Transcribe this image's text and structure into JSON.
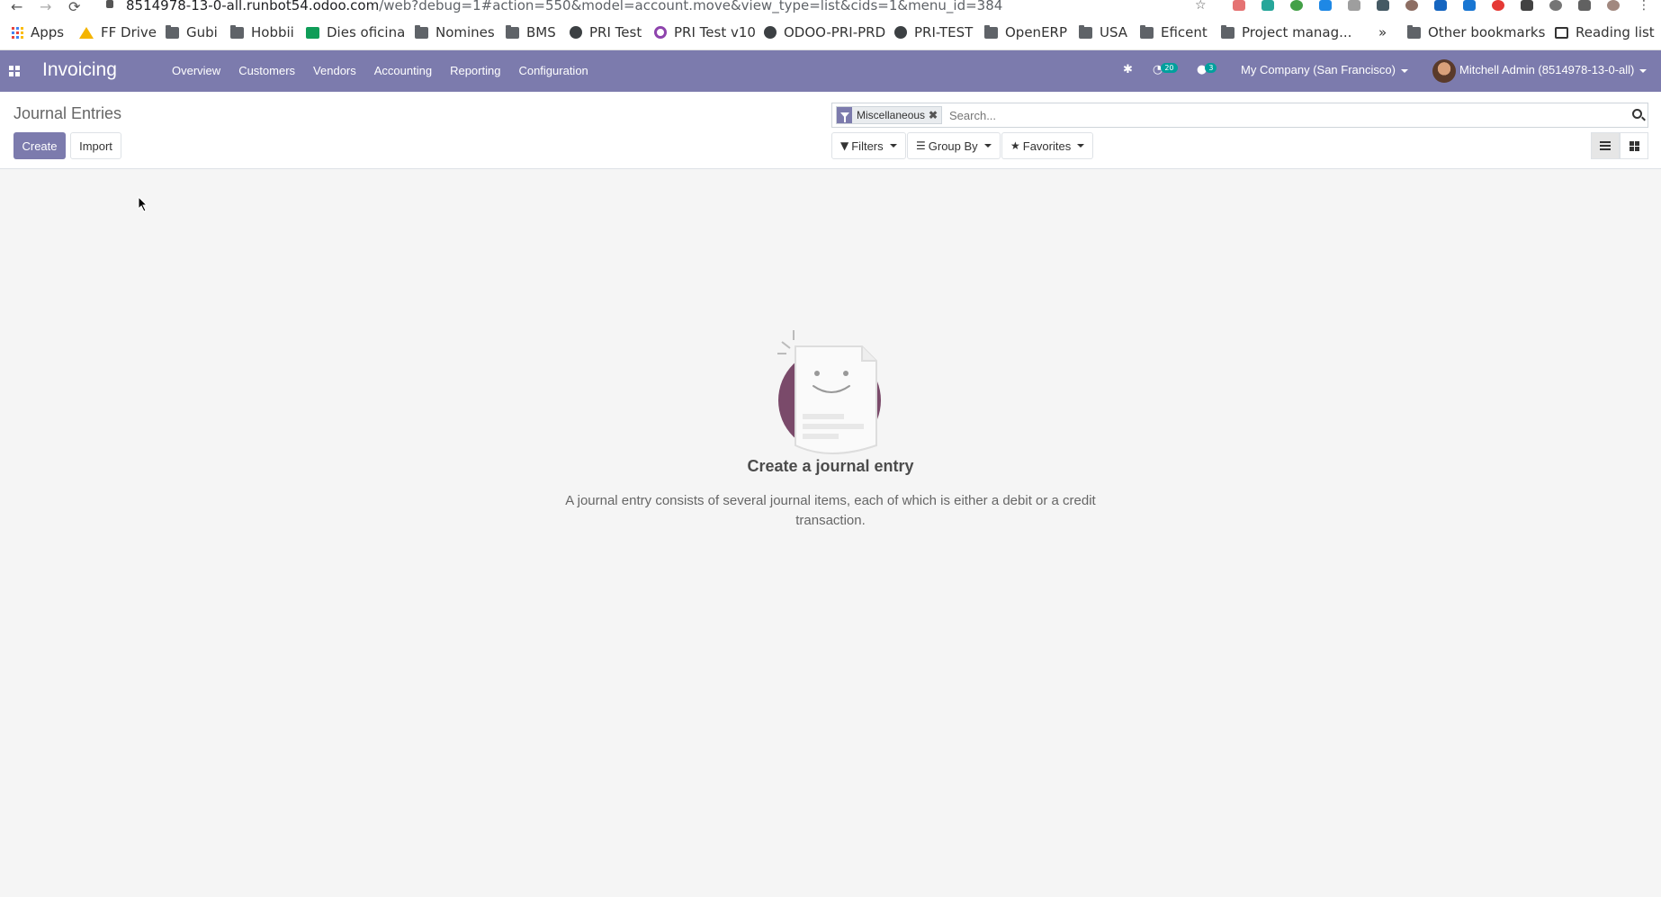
{
  "browser": {
    "url_host": "8514978-13-0-all.runbot54.odoo.com",
    "url_path": "/web?debug=1#action=550&model=account.move&view_type=list&cids=1&menu_id=384",
    "bookmarks": [
      {
        "label": "Apps",
        "icon": "apps-grid-icon"
      },
      {
        "label": "FF Drive",
        "icon": "google-drive-icon"
      },
      {
        "label": "Gubi",
        "icon": "folder-icon"
      },
      {
        "label": "Hobbii",
        "icon": "folder-icon"
      },
      {
        "label": "Dies oficina",
        "icon": "sheets-icon"
      },
      {
        "label": "Nomines",
        "icon": "folder-icon"
      },
      {
        "label": "BMS",
        "icon": "folder-icon"
      },
      {
        "label": "PRI Test",
        "icon": "globe-icon"
      },
      {
        "label": "PRI Test v10",
        "icon": "odoo-ring-icon"
      },
      {
        "label": "ODOO-PRI-PRD",
        "icon": "globe-icon"
      },
      {
        "label": "PRI-TEST",
        "icon": "globe-icon"
      },
      {
        "label": "OpenERP",
        "icon": "folder-icon"
      },
      {
        "label": "USA",
        "icon": "folder-icon"
      },
      {
        "label": "Eficent",
        "icon": "folder-icon"
      },
      {
        "label": "Project manag...",
        "icon": "folder-icon"
      }
    ],
    "overflow_label": "»",
    "other_bookmarks": "Other bookmarks",
    "reading_list": "Reading list"
  },
  "navbar": {
    "app_name": "Invoicing",
    "menu": [
      "Overview",
      "Customers",
      "Vendors",
      "Accounting",
      "Reporting",
      "Configuration"
    ],
    "activity_count": "20",
    "messages_count": "3",
    "company": "My Company (San Francisco)",
    "user": "Mitchell Admin (8514978-13-0-all)",
    "accent_color": "#7c7bad"
  },
  "control_panel": {
    "breadcrumb": "Journal Entries",
    "create_label": "Create",
    "import_label": "Import",
    "facet_label": "Miscellaneous",
    "search_placeholder": "Search...",
    "filters_label": "Filters",
    "groupby_label": "Group By",
    "favorites_label": "Favorites",
    "active_view": "list"
  },
  "empty_state": {
    "title": "Create a journal entry",
    "description": "A journal entry consists of several journal items, each of which is either a debit or a credit transaction."
  }
}
